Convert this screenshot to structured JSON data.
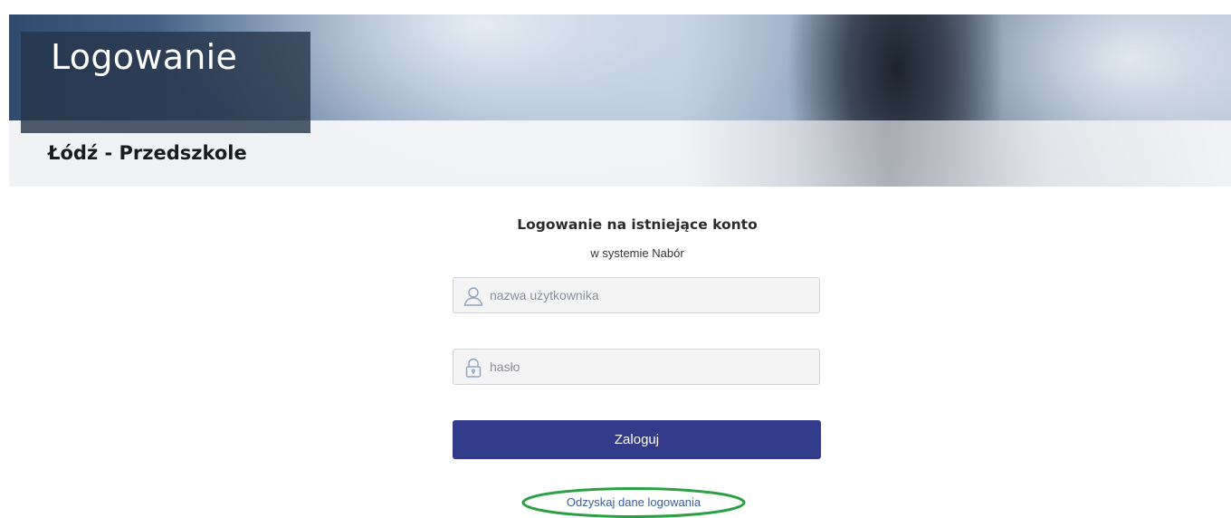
{
  "banner": {
    "title": "Logowanie",
    "subtitle": "Łódź - Przedszkole"
  },
  "login": {
    "heading": "Logowanie na istniejące konto",
    "subheading": "w systemie Nabór",
    "username": {
      "placeholder": "nazwa użytkownika",
      "value": "",
      "icon": "user-icon"
    },
    "password": {
      "placeholder": "hasło",
      "value": "",
      "icon": "lock-icon"
    },
    "submit_label": "Zaloguj",
    "recover_label": "Odzyskaj dane logowania"
  },
  "colors": {
    "button": "#323c8a",
    "link": "#3a5f9e",
    "highlight_oval": "#2ea043",
    "title_box": "#263448"
  }
}
